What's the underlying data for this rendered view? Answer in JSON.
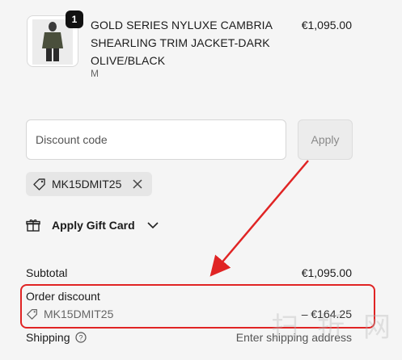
{
  "product": {
    "quantity": "1",
    "title": "GOLD SERIES NYLUXE CAMBRIA SHEARLING TRIM JACKET-DARK OLIVE/BLACK",
    "variant": "M",
    "price": "€1,095.00"
  },
  "discount": {
    "placeholder": "Discount code",
    "apply_label": "Apply",
    "applied_code": "MK15DMIT25"
  },
  "gift_card": {
    "label": "Apply Gift Card"
  },
  "summary": {
    "subtotal_label": "Subtotal",
    "subtotal_value": "€1,095.00",
    "order_discount_label": "Order discount",
    "order_discount_code": "MK15DMIT25",
    "order_discount_value": "– €164.25",
    "shipping_label": "Shipping",
    "shipping_value": "Enter shipping address"
  },
  "watermark": "扫 折 网",
  "colors": {
    "annotation": "#e02424",
    "badge": "#111111"
  }
}
